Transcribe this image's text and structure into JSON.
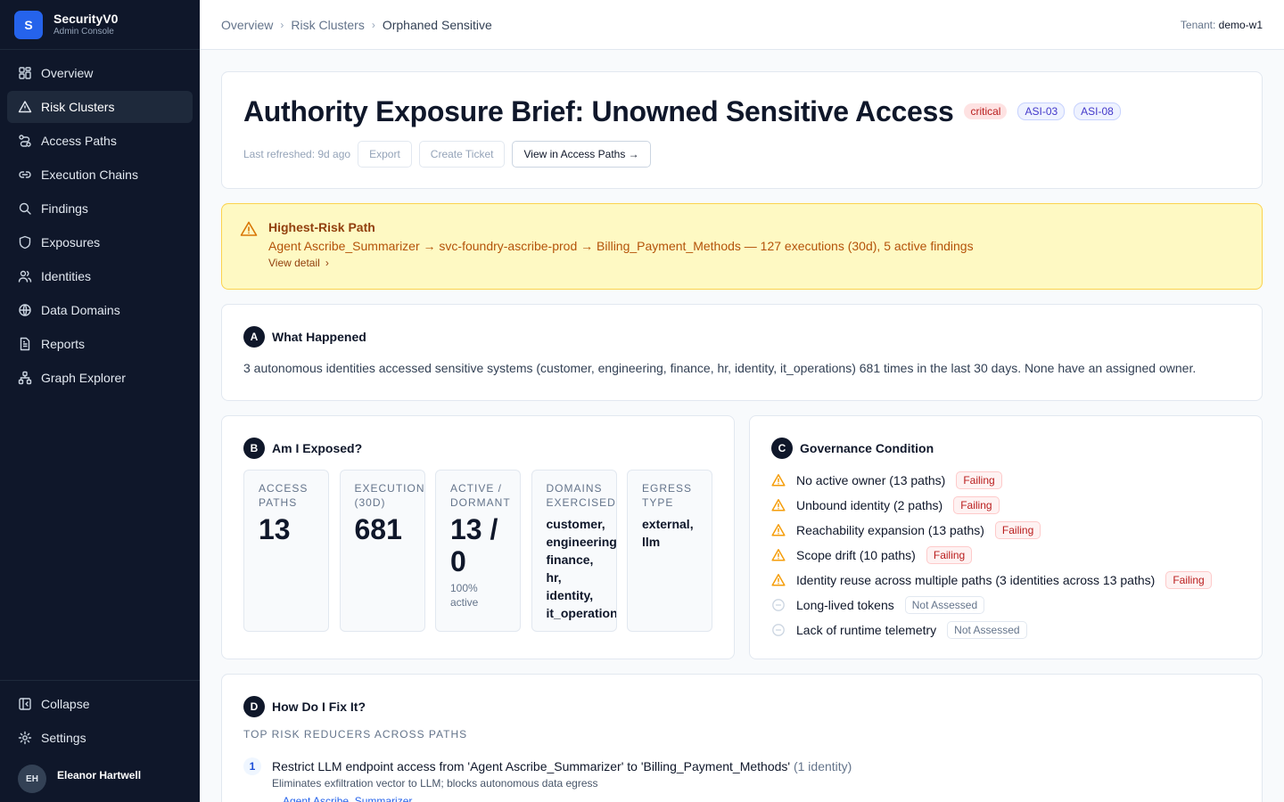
{
  "brand": {
    "logo_letter": "S",
    "name": "SecurityV0",
    "subtitle": "Admin Console"
  },
  "sidebar": {
    "items": [
      {
        "label": "Overview",
        "icon": "grid-icon"
      },
      {
        "label": "Risk Clusters",
        "icon": "warning-triangle-icon",
        "active": true
      },
      {
        "label": "Access Paths",
        "icon": "path-icon"
      },
      {
        "label": "Execution Chains",
        "icon": "link-icon"
      },
      {
        "label": "Findings",
        "icon": "search-icon"
      },
      {
        "label": "Exposures",
        "icon": "shield-icon"
      },
      {
        "label": "Identities",
        "icon": "users-icon"
      },
      {
        "label": "Data Domains",
        "icon": "globe-icon"
      },
      {
        "label": "Reports",
        "icon": "document-icon"
      },
      {
        "label": "Graph Explorer",
        "icon": "graph-icon"
      }
    ],
    "collapse_label": "Collapse",
    "settings_label": "Settings",
    "user": {
      "initials": "EH",
      "name": "Eleanor Hartwell"
    }
  },
  "breadcrumb": [
    "Overview",
    "Risk Clusters",
    "Orphaned Sensitive"
  ],
  "tenant": {
    "label": "Tenant:",
    "value": "demo-w1"
  },
  "header": {
    "title": "Authority Exposure Brief: Unowned Sensitive Access",
    "severity": "critical",
    "tags": [
      "ASI-03",
      "ASI-08"
    ],
    "last_refreshed": "Last refreshed: 9d ago",
    "export_label": "Export",
    "create_ticket_label": "Create Ticket",
    "view_paths_label": "View in Access Paths →"
  },
  "alert": {
    "title": "Highest-Risk Path",
    "body": "Agent Ascribe_Summarizer → svc-foundry-ascribe-prod → Billing_Payment_Methods — 127 executions (30d), 5 active findings",
    "link": "View detail",
    "color": "#92400e"
  },
  "section_a": {
    "letter": "A",
    "title": "What Happened",
    "text": "3 autonomous identities accessed sensitive systems (customer, engineering, finance, hr, identity, it_operations) 681 times in the last 30 days. None have an assigned owner."
  },
  "section_b": {
    "letter": "B",
    "title": "Am I Exposed?",
    "metrics": [
      {
        "label": "Access Paths",
        "value": "13"
      },
      {
        "label": "Executions (30D)",
        "value": "681"
      },
      {
        "label": "Active / Dormant",
        "value": "13 / 0",
        "sub": "100% active"
      },
      {
        "label": "Domains Exercised",
        "text": "customer,\nengineering,\nfinance,\nhr,\nidentity,\nit_operations"
      },
      {
        "label": "Egress Type",
        "text": "external,\nllm"
      }
    ]
  },
  "section_c": {
    "letter": "C",
    "title": "Governance Condition",
    "items": [
      {
        "label": "No active owner (13 paths)",
        "status": "Failing"
      },
      {
        "label": "Unbound identity (2 paths)",
        "status": "Failing"
      },
      {
        "label": "Reachability expansion (13 paths)",
        "status": "Failing"
      },
      {
        "label": "Scope drift (10 paths)",
        "status": "Failing"
      },
      {
        "label": "Identity reuse across multiple paths (3 identities across 13 paths)",
        "status": "Failing"
      },
      {
        "label": "Long-lived tokens",
        "status": "Not Assessed"
      },
      {
        "label": "Lack of runtime telemetry",
        "status": "Not Assessed"
      }
    ]
  },
  "section_d": {
    "letter": "D",
    "title": "How Do I Fix It?",
    "subheading": "Top Risk Reducers Across Paths",
    "fixes": [
      {
        "num": "1",
        "title": "Restrict LLM endpoint access from 'Agent Ascribe_Summarizer' to 'Billing_Payment_Methods'",
        "scope": "(1 identity)",
        "desc": "Eliminates exfiltration vector to LLM; blocks autonomous data egress",
        "link": "Agent Ascribe_Summarizer"
      }
    ]
  }
}
